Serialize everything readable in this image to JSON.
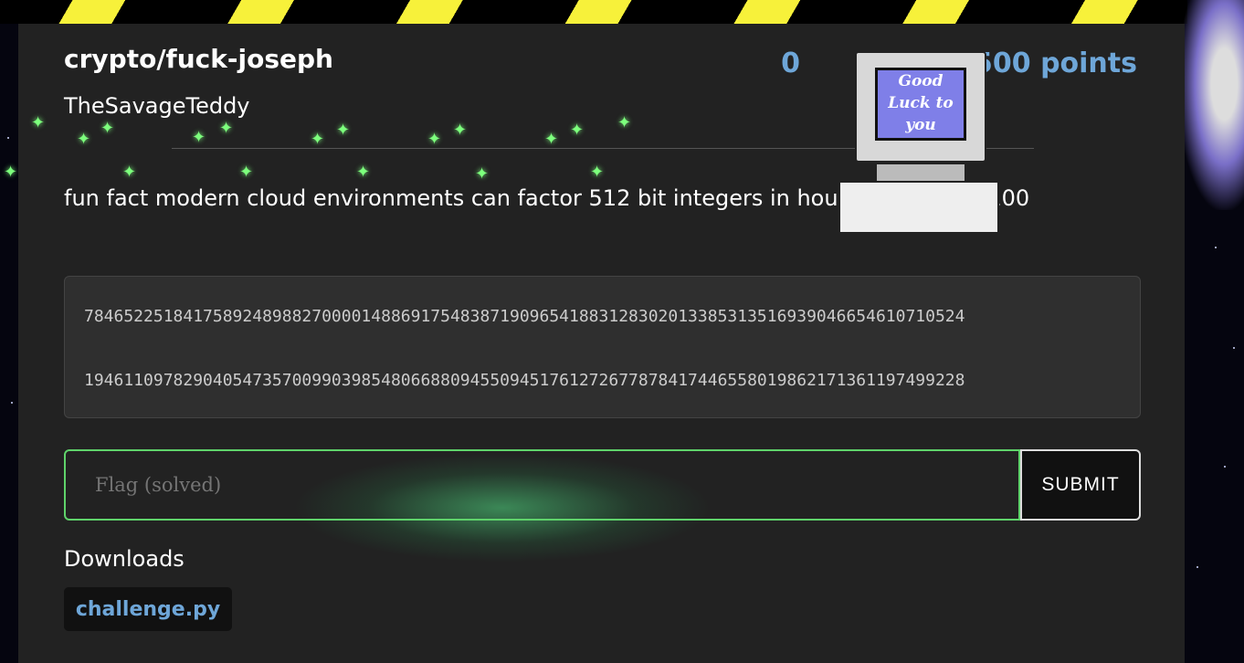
{
  "challenge": {
    "title": "crypto/fuck-joseph",
    "author": "TheSavageTeddy",
    "solves": "0",
    "points": "500 points",
    "description": "fun fact modern cloud environments can factor 512 bit integers in hours for under $100",
    "numbers": [
      "78465225184175892489882700001488691754838719096541883128302013385313516939046654610710524",
      "19461109782904054735700990398548066880945509451761272677878417446558019862171361197499228"
    ]
  },
  "flag": {
    "placeholder": "Flag (solved)",
    "submit_label": "SUBMIT"
  },
  "downloads": {
    "heading": "Downloads",
    "files": [
      "challenge.py"
    ]
  },
  "decor": {
    "computer_text": "Good Luck to you"
  }
}
